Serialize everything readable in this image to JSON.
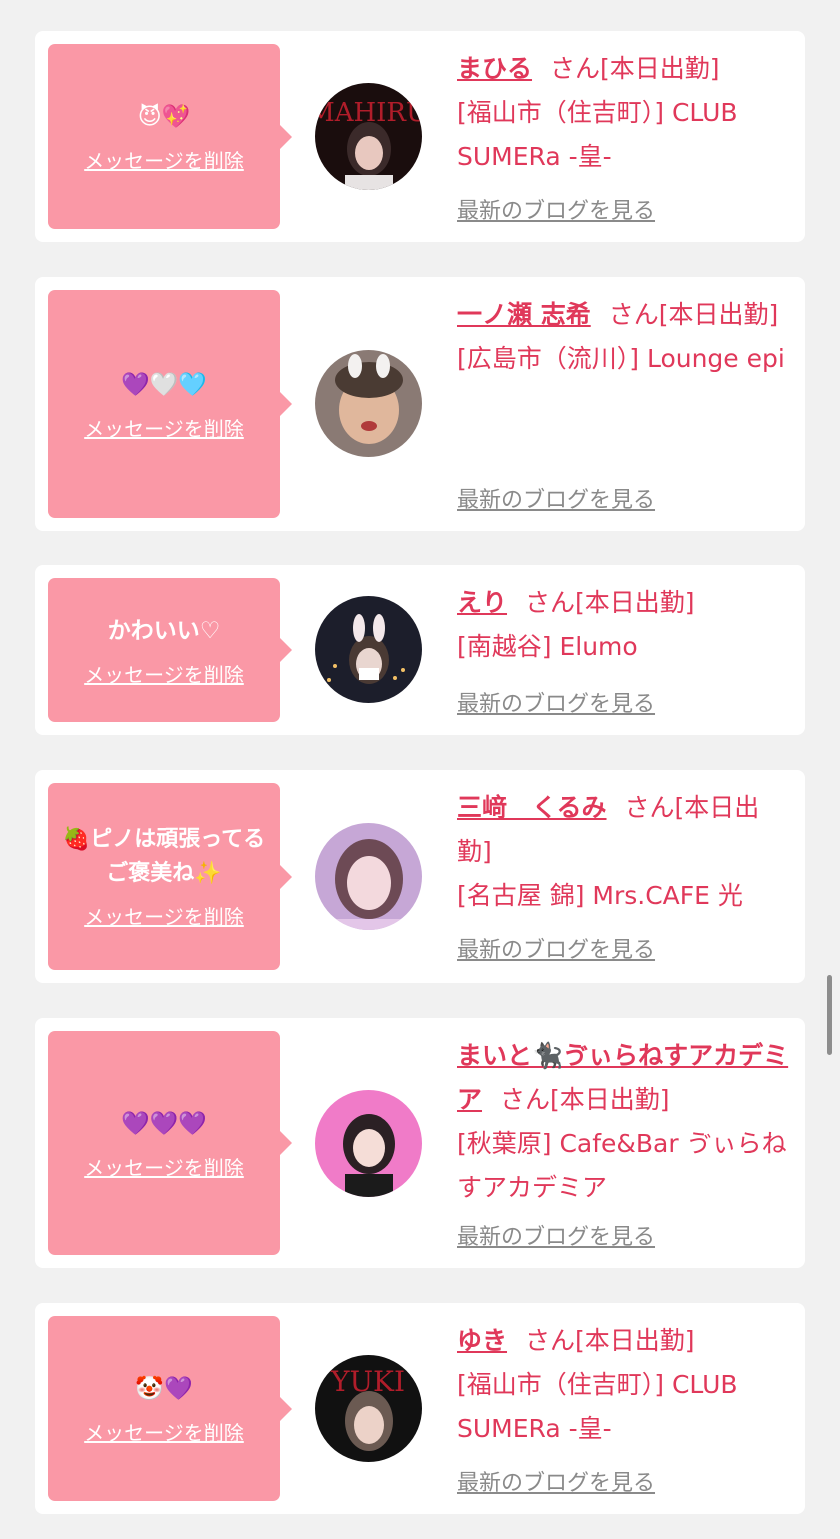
{
  "entries": [
    {
      "message": "😈💖",
      "delete_label": "メッセージを削除",
      "name": "まひる",
      "honorific": "さん[本日出勤]",
      "location": "[福山市（住吉町）] CLUB SUMERa -皇-",
      "blog_label": "最新のブログを見る",
      "avatar_text": "MAHIRU"
    },
    {
      "message": "💜🤍🩵",
      "delete_label": "メッセージを削除",
      "name": "一ノ瀬 志希",
      "honorific": "さん[本日出勤]",
      "location": "[広島市（流川）] Lounge epi",
      "blog_label": "最新のブログを見る",
      "avatar_text": ""
    },
    {
      "message": "かわいい♡",
      "delete_label": "メッセージを削除",
      "name": "えり",
      "honorific": "さん[本日出勤]",
      "location": "[南越谷] Elumo",
      "blog_label": "最新のブログを見る",
      "avatar_text": ""
    },
    {
      "message": "🍓ピノは頑張ってるご褒美ね✨",
      "delete_label": "メッセージを削除",
      "name": "三﨑　くるみ",
      "honorific": "さん[本日出勤]",
      "location": "[名古屋 錦] Mrs.CAFE 光",
      "blog_label": "最新のブログを見る",
      "avatar_text": ""
    },
    {
      "message": "💜💜💜",
      "delete_label": "メッセージを削除",
      "name": "まいと🐈‍⬛ゔぃらねすアカデミア",
      "honorific": "さん[本日出勤]",
      "location": "[秋葉原] Cafe&Bar ゔぃらねすアカデミア",
      "blog_label": "最新のブログを見る",
      "avatar_text": ""
    },
    {
      "message": "🤡💜",
      "delete_label": "メッセージを削除",
      "name": "ゆき",
      "honorific": "さん[本日出勤]",
      "location": "[福山市（住吉町）] CLUB SUMERa -皇-",
      "blog_label": "最新のブログを見る",
      "avatar_text": "YUKI"
    }
  ]
}
